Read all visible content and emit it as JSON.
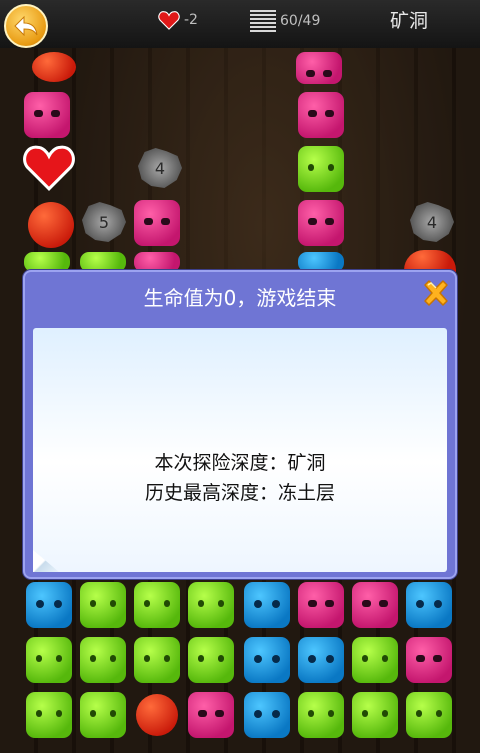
{
  "header": {
    "lives": "-2",
    "progress": "60/49",
    "location": "矿洞"
  },
  "board": {
    "rock_values": [
      "4",
      "5",
      "4"
    ]
  },
  "dialog": {
    "title": "生命值为0，游戏结束",
    "depth_line": "本次探险深度：矿洞",
    "record_line": "历史最高深度：冻土层"
  },
  "colors": {
    "dialog_header": "#6f75d4",
    "accent_gold": "#e89a12",
    "pink_tile": "#c4166e",
    "green_tile": "#56b80c",
    "blue_tile": "#0a78c4"
  },
  "icons": [
    "back-arrow-icon",
    "heart-icon",
    "level-bars-icon",
    "close-x-icon"
  ]
}
